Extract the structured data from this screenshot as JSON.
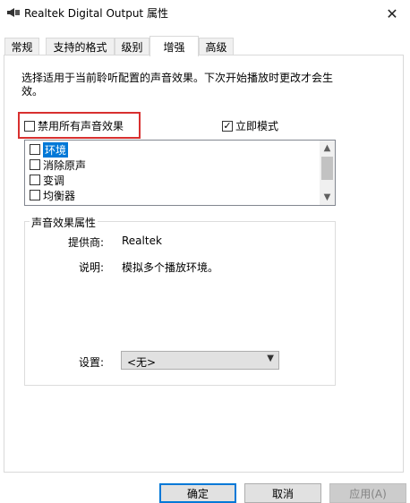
{
  "window": {
    "title": "Realtek Digital Output 属性",
    "close_glyph": "✕"
  },
  "tabs": [
    {
      "label": "常规"
    },
    {
      "label": "支持的格式"
    },
    {
      "label": "级别"
    },
    {
      "label": "增强",
      "active": true
    },
    {
      "label": "高级"
    }
  ],
  "enhance": {
    "description": "选择适用于当前聆听配置的声音效果。下次开始播放时更改才会生效。",
    "disable_all": {
      "label": "禁用所有声音效果",
      "checked": false
    },
    "immediate_mode": {
      "label": "立即模式",
      "checked": true
    },
    "effects": [
      {
        "label": "环境",
        "checked": false,
        "selected": true
      },
      {
        "label": "消除原声",
        "checked": false
      },
      {
        "label": "变调",
        "checked": false
      },
      {
        "label": "均衡器",
        "checked": false
      }
    ],
    "properties": {
      "title": "声音效果属性",
      "provider_label": "提供商:",
      "provider_value": "Realtek",
      "desc_label": "说明:",
      "desc_value": "模拟多个播放环境。",
      "setting_label": "设置:",
      "setting_value": "<无>"
    }
  },
  "buttons": {
    "ok": "确定",
    "cancel": "取消",
    "apply": "应用(A)"
  },
  "colors": {
    "highlight_border": "#d8302f",
    "selection": "#0078d7"
  }
}
